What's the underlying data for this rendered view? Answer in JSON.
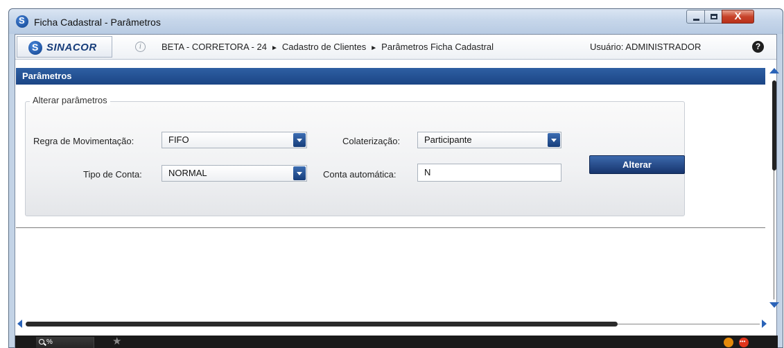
{
  "window": {
    "title": "Ficha Cadastral - Parâmetros",
    "close_label": "X"
  },
  "navbar": {
    "logo": "SINACOR",
    "info_label": "i",
    "breadcrumb": [
      "BETA - CORRETORA - 24",
      "Cadastro de Clientes",
      "Parâmetros Ficha Cadastral"
    ],
    "user_label": "Usuário: ADMINISTRADOR",
    "help_label": "?"
  },
  "section": {
    "title": "Parâmetros"
  },
  "form": {
    "legend": "Alterar parâmetros",
    "regra_label": "Regra de Movimentação:",
    "regra_value": "FIFO",
    "colateralizacao_label": "Colaterização:",
    "colateralizacao_value": "Participante",
    "tipo_label": "Tipo de Conta:",
    "tipo_value": "NORMAL",
    "conta_label": "Conta automática:",
    "conta_value": "N",
    "alterar_button": "Alterar"
  },
  "statusbar": {
    "zoom_label": "%"
  },
  "colors": {
    "accent": "#1b4585",
    "header_bg": "#2e5fa3",
    "window_frame": "#c3d3e6"
  },
  "icons": [
    "app-logo-icon",
    "info-icon",
    "help-icon",
    "dropdown-arrow-icon",
    "star-icon",
    "magnifier-icon"
  ]
}
